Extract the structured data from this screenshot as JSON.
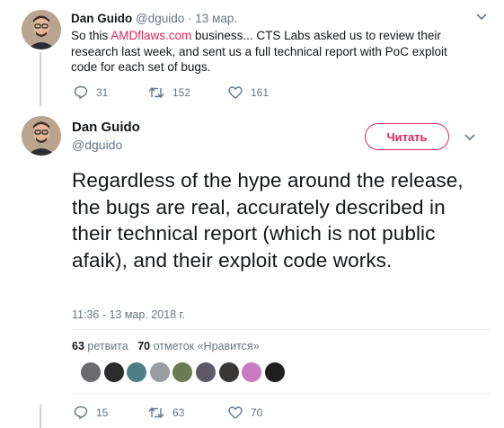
{
  "tweet1": {
    "name": "Dan Guido",
    "handle": "@dguido",
    "separator": "·",
    "date": "13 мар.",
    "text_before": "So this ",
    "link": "AMDflaws.com",
    "text_after": " business... CTS Labs asked us to review their research last week, and sent us a full technical report with PoC exploit code for each set of bugs.",
    "replies": "31",
    "retweets": "152",
    "likes": "161"
  },
  "tweet2": {
    "name": "Dan Guido",
    "handle": "@dguido",
    "follow_label": "Читать",
    "text": "Regardless of the hype around the release, the bugs are real, accurately described in their technical report (which is not public afaik), and their exploit code works.",
    "timestamp": "11:36 - 13 мар. 2018 г.",
    "retweet_count": "63",
    "retweet_label": "ретвита",
    "like_count": "70",
    "like_label": "отметок «Нравится»",
    "replies": "15",
    "retweets": "63",
    "likes": "70"
  },
  "icons": [
    "reply-icon",
    "retweet-icon",
    "heart-icon",
    "chevron-down-icon"
  ],
  "colors": {
    "accent": "#e0245e",
    "muted": "#657786",
    "text": "#14171a",
    "thread": "#e6c9cd"
  },
  "likers": [
    "#6b6a6e",
    "#2c2c2e",
    "#4f7f86",
    "#9a9ea2",
    "#6b7b54",
    "#5d5a64",
    "#3a3737",
    "#c87ac2",
    "#1f1f1f"
  ]
}
